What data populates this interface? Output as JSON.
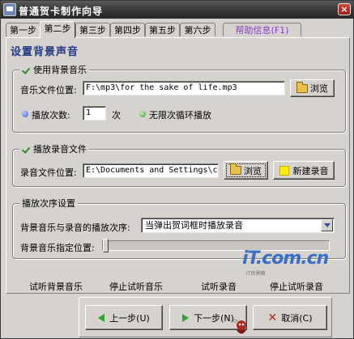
{
  "window": {
    "title": "普通贺卡制作向导",
    "close_glyph": "×"
  },
  "tabs": [
    {
      "label": "第一步"
    },
    {
      "label": "第二步"
    },
    {
      "label": "第三步"
    },
    {
      "label": "第四步"
    },
    {
      "label": "第五步"
    },
    {
      "label": "第六步"
    },
    {
      "label": "帮助信息(F1)"
    }
  ],
  "page_title": "设置背景声音",
  "bg_music": {
    "legend": "使用背景音乐",
    "file_label": "音乐文件位置:",
    "file_value": "F:\\mp3\\for the sake of life.mp3",
    "browse_label": "浏览",
    "play_count_label": "播放次数:",
    "play_count_value": "1",
    "times_unit": "次",
    "loop_label": "无限次循环播放"
  },
  "recording": {
    "legend": "播放录音文件",
    "file_label": "录音文件位置:",
    "file_value": "E:\\Documents and Settings\\cl:",
    "browse_label": "浏览",
    "new_record_label": "新建录音"
  },
  "play_order": {
    "legend": "播放次序设置",
    "order_label": "背景音乐与录音的播放次序:",
    "order_value": "当弹出贺词框时播放录音",
    "position_label": "背景音乐指定位置:",
    "position_fraction": 0.0
  },
  "actions": {
    "preview_bg": "试听背景音乐",
    "stop_preview_bg": "停止试听音乐",
    "preview_rec": "试听录音",
    "stop_preview_rec": "停止试听录音"
  },
  "watermark": {
    "text": "iT.com.cn",
    "sub": "IT世界网"
  },
  "nav": {
    "prev_label": "上一步(U)",
    "next_label": "下一步(N)",
    "cancel_label": "取消(C)"
  }
}
